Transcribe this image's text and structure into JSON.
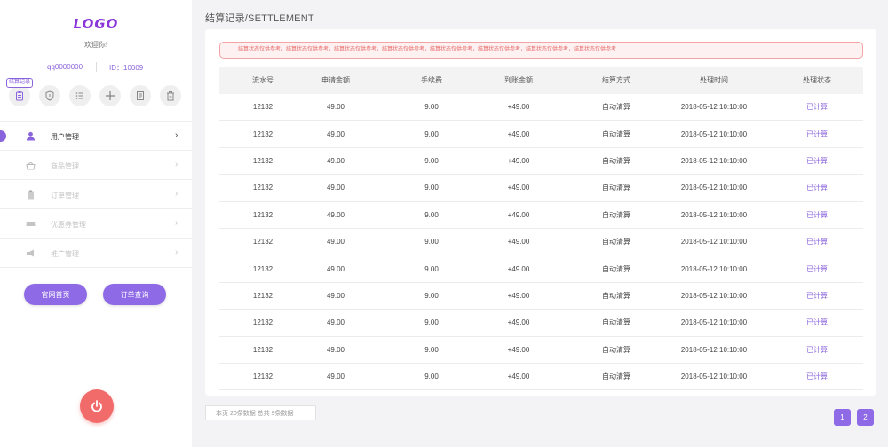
{
  "sidebar": {
    "logo": "LOGO",
    "welcome": "欢迎你!",
    "account": "qq0000000",
    "user_id": "ID：10009",
    "tool_badge": "结算记录",
    "tools": [
      {
        "icon": "clipboard-icon"
      },
      {
        "icon": "shield-alert-icon"
      },
      {
        "icon": "list-icon"
      },
      {
        "icon": "plus-icon"
      },
      {
        "icon": "document-icon"
      },
      {
        "icon": "trash-icon"
      }
    ],
    "menu": [
      {
        "label": "用户管理",
        "icon": "user-icon",
        "active": true
      },
      {
        "label": "商品管理",
        "icon": "basket-icon",
        "active": false
      },
      {
        "label": "订单管理",
        "icon": "order-clipboard-icon",
        "active": false
      },
      {
        "label": "优惠券管理",
        "icon": "ticket-icon",
        "active": false
      },
      {
        "label": "推广管理",
        "icon": "megaphone-icon",
        "active": false
      }
    ],
    "buttons": {
      "home": "官网首页",
      "order_query": "订单查询"
    },
    "power_icon": "power-icon"
  },
  "main": {
    "title": "结算记录/SETTLEMENT",
    "notice": "结算状态仅供参考，结算状态仅供参考，结算状态仅供参考，结算状态仅供参考，结算状态仅供参考，结算状态仅供参考，结算状态仅供参考，结算状态仅供参考",
    "columns": [
      "流水号",
      "申请金额",
      "手续费",
      "到账金额",
      "结算方式",
      "处理时间",
      "处理状态"
    ],
    "rows": [
      [
        "12132",
        "49.00",
        "9.00",
        "+49.00",
        "自动清算",
        "2018-05-12   10:10:00",
        "已计算"
      ],
      [
        "12132",
        "49.00",
        "9.00",
        "+49.00",
        "自动清算",
        "2018-05-12   10:10:00",
        "已计算"
      ],
      [
        "12132",
        "49.00",
        "9.00",
        "+49.00",
        "自动清算",
        "2018-05-12   10:10:00",
        "已计算"
      ],
      [
        "12132",
        "49.00",
        "9.00",
        "+49.00",
        "自动清算",
        "2018-05-12   10:10:00",
        "已计算"
      ],
      [
        "12132",
        "49.00",
        "9.00",
        "+49.00",
        "自动清算",
        "2018-05-12   10:10:00",
        "已计算"
      ],
      [
        "12132",
        "49.00",
        "9.00",
        "+49.00",
        "自动清算",
        "2018-05-12   10:10:00",
        "已计算"
      ],
      [
        "12132",
        "49.00",
        "9.00",
        "+49.00",
        "自动清算",
        "2018-05-12   10:10:00",
        "已计算"
      ],
      [
        "12132",
        "49.00",
        "9.00",
        "+49.00",
        "自动清算",
        "2018-05-12   10:10:00",
        "已计算"
      ],
      [
        "12132",
        "49.00",
        "9.00",
        "+49.00",
        "自动清算",
        "2018-05-12   10:10:00",
        "已计算"
      ],
      [
        "12132",
        "49.00",
        "9.00",
        "+49.00",
        "自动清算",
        "2018-05-12   10:10:00",
        "已计算"
      ],
      [
        "12132",
        "49.00",
        "9.00",
        "+49.00",
        "自动清算",
        "2018-05-12   10:10:00",
        "已计算"
      ]
    ],
    "pagination": {
      "info": "本页   20条数据  总共   9条数据",
      "pages": [
        "1",
        "2"
      ]
    }
  },
  "colors": {
    "accent": "#8f6ae6",
    "logo": "#8a35d9",
    "danger": "#f16b6b",
    "notice_text": "#e86a6a"
  }
}
